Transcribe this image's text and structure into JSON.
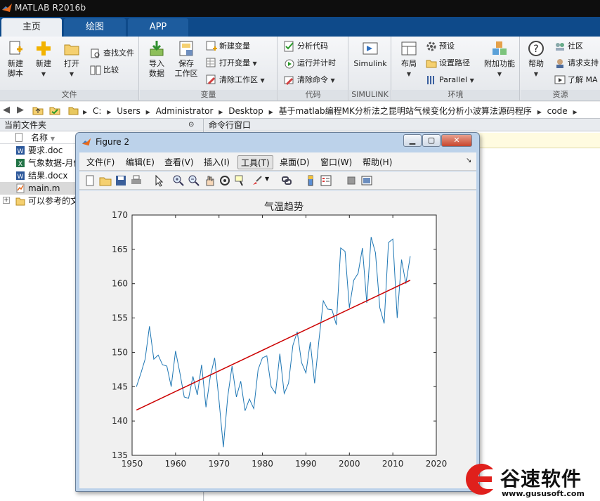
{
  "window": {
    "title": "MATLAB R2016b"
  },
  "tabs": [
    {
      "label": "主页",
      "active": true
    },
    {
      "label": "绘图",
      "active": false
    },
    {
      "label": "APP",
      "active": false
    }
  ],
  "ribbon": {
    "file": {
      "section": "文件",
      "new_script": "新建\n脚本",
      "new": "新建",
      "open": "打开",
      "find_files": "查找文件",
      "compare": "比较"
    },
    "variable": {
      "section": "变量",
      "import": "导入\n数据",
      "save_ws": "保存\n工作区",
      "new_var": "新建变量",
      "open_var": "打开变量",
      "clear_ws": "清除工作区"
    },
    "code": {
      "section": "代码",
      "analyze": "分析代码",
      "run_time": "运行并计时",
      "clear_cmd": "清除命令"
    },
    "simulink": {
      "section": "SIMULINK",
      "label": "Simulink"
    },
    "environment": {
      "section": "环境",
      "layout": "布局",
      "preferences": "预设",
      "set_path": "设置路径",
      "parallel": "Parallel",
      "addons": "附加功能"
    },
    "resources": {
      "section": "资源",
      "help": "帮助",
      "community": "社区",
      "request_support": "请求支持",
      "learn": "了解 MA"
    }
  },
  "address": {
    "crumbs": [
      "C:",
      "Users",
      "Administrator",
      "Desktop",
      "基于matlab编程MK分析法之昆明站气候变化分析小波算法源码程序",
      "code"
    ]
  },
  "file_panel": {
    "title": "当前文件夹",
    "column": "名称",
    "files": [
      {
        "name": "要求.doc",
        "icon": "word-doc-icon",
        "selected": false
      },
      {
        "name": "气象数据-月份",
        "icon": "excel-icon",
        "selected": false
      },
      {
        "name": "结果.docx",
        "icon": "word-doc-icon",
        "selected": false
      },
      {
        "name": "main.m",
        "icon": "m-file-icon",
        "selected": true
      },
      {
        "name": "可以参考的文",
        "icon": "folder-icon",
        "selected": false
      }
    ]
  },
  "command_window": {
    "title": "命令行窗口"
  },
  "figure": {
    "title": "Figure 2",
    "menu": [
      {
        "label": "文件(F)",
        "active": false
      },
      {
        "label": "编辑(E)",
        "active": false
      },
      {
        "label": "查看(V)",
        "active": false
      },
      {
        "label": "插入(I)",
        "active": false
      },
      {
        "label": "工具(T)",
        "active": true
      },
      {
        "label": "桌面(D)",
        "active": false
      },
      {
        "label": "窗口(W)",
        "active": false
      },
      {
        "label": "帮助(H)",
        "active": false
      }
    ],
    "toolbar_icons": [
      "new-figure-icon",
      "open-icon",
      "save-icon",
      "print-icon",
      "pointer-icon",
      "zoom-in-icon",
      "zoom-out-icon",
      "pan-icon",
      "rotate-icon",
      "data-cursor-icon",
      "brush-icon",
      "link-icon",
      "colorbar-icon",
      "legend-icon",
      "hide-tools-icon",
      "dock-icon"
    ]
  },
  "chart_data": {
    "type": "line",
    "title": "气温趋势",
    "xlabel": "",
    "ylabel": "",
    "xlim": [
      1950,
      2020
    ],
    "ylim": [
      135,
      170
    ],
    "xticks": [
      1950,
      1960,
      1970,
      1980,
      1990,
      2000,
      2010,
      2020
    ],
    "yticks": [
      135,
      140,
      145,
      150,
      155,
      160,
      165,
      170
    ],
    "grid": false,
    "series": [
      {
        "color": "#1f77b4",
        "x": [
          1951,
          1952,
          1953,
          1954,
          1955,
          1956,
          1957,
          1958,
          1959,
          1960,
          1961,
          1962,
          1963,
          1964,
          1965,
          1966,
          1967,
          1968,
          1969,
          1970,
          1971,
          1972,
          1973,
          1974,
          1975,
          1976,
          1977,
          1978,
          1979,
          1980,
          1981,
          1982,
          1983,
          1984,
          1985,
          1986,
          1987,
          1988,
          1989,
          1990,
          1991,
          1992,
          1993,
          1994,
          1995,
          1996,
          1997,
          1998,
          1999,
          2000,
          2001,
          2002,
          2003,
          2004,
          2005,
          2006,
          2007,
          2008,
          2009,
          2010,
          2011,
          2012,
          2013,
          2014
        ],
        "y": [
          145.0,
          146.9,
          149.0,
          153.8,
          149.0,
          149.6,
          148.2,
          148.0,
          145.0,
          150.2,
          147.0,
          143.5,
          143.3,
          146.5,
          143.8,
          148.2,
          142.0,
          146.5,
          149.2,
          143.0,
          136.2,
          143.5,
          148.0,
          143.5,
          145.8,
          141.5,
          143.2,
          141.8,
          147.5,
          149.2,
          149.5,
          145.0,
          144.0,
          149.8,
          144.0,
          145.5,
          151.0,
          153.0,
          148.5,
          147.0,
          151.5,
          145.5,
          151.8,
          157.5,
          156.3,
          156.2,
          154.0,
          165.2,
          164.7,
          156.5,
          160.5,
          161.5,
          165.2,
          157.2,
          166.8,
          164.5,
          156.5,
          154.2,
          166.0,
          166.5,
          155.0,
          163.5,
          160.0,
          164.0
        ]
      },
      {
        "color": "#cc0000",
        "x": [
          1951,
          2014
        ],
        "y": [
          141.6,
          160.5
        ]
      }
    ]
  },
  "watermark": {
    "text": "谷速软件",
    "url": "www.gususoft.com"
  }
}
